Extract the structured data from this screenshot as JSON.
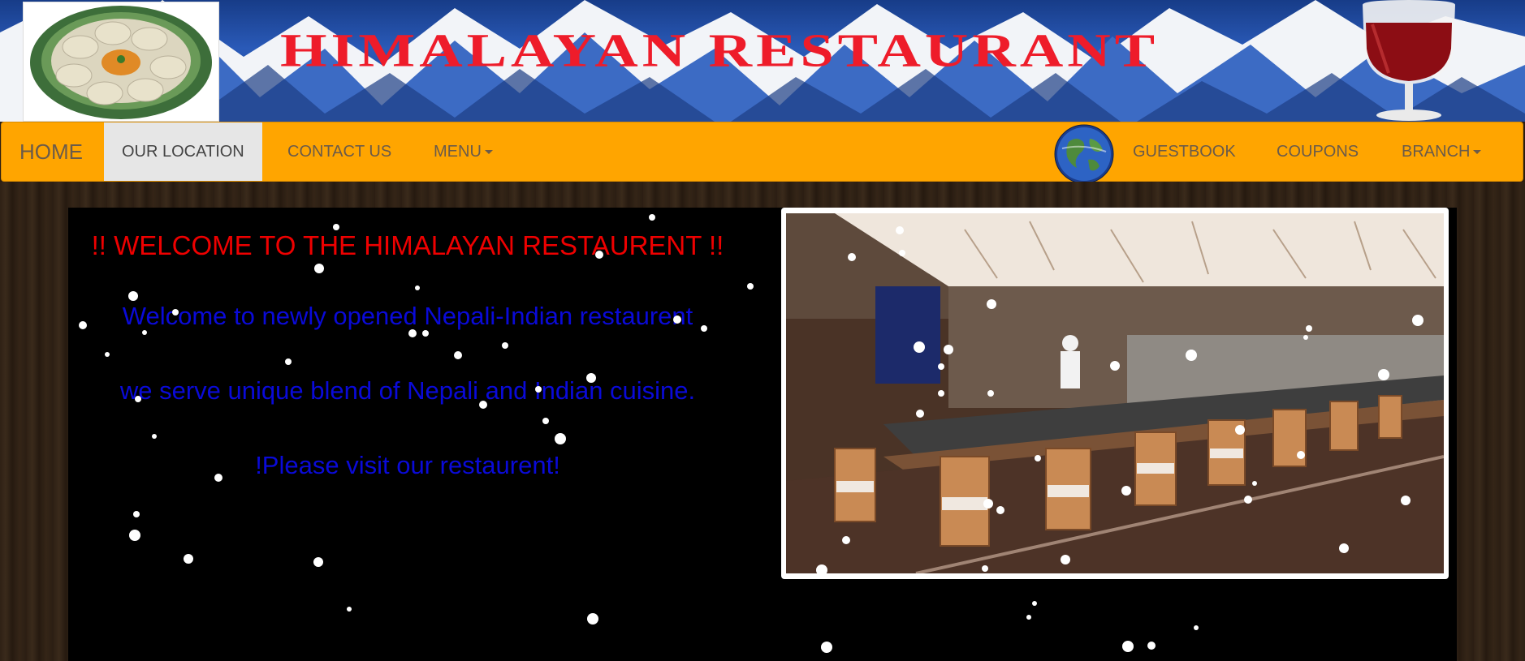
{
  "banner": {
    "title": "HIMALAYAN RESTAURANT",
    "left_image": "dumplings-plate-image",
    "right_image": "wine-glass-image",
    "title_color": "#ee1c2a"
  },
  "navbar": {
    "brand": "HOME",
    "items_left": [
      {
        "label": "OUR LOCATION",
        "active": true
      },
      {
        "label": "CONTACT US",
        "active": false
      },
      {
        "label": "MENU",
        "dropdown": true
      }
    ],
    "items_right": [
      {
        "label": "GUESTBOOK"
      },
      {
        "label": "COUPONS"
      },
      {
        "label": "BRANCH",
        "dropdown": true
      }
    ],
    "globe_icon": "globe-icon",
    "background": "#ffa500"
  },
  "content": {
    "welcome": "!! WELCOME TO THE HIMALAYAN RESTAURENT !!",
    "line1": "Welcome to newly opened Nepali-Indian restaurent",
    "line2": "we serve unique blend of Nepali and Indian cuisine.",
    "line3": "!Please visit our restaurent!",
    "welcome_color": "#ee0000",
    "body_color": "#0a0ad8",
    "photo": "restaurant-interior-photo"
  }
}
